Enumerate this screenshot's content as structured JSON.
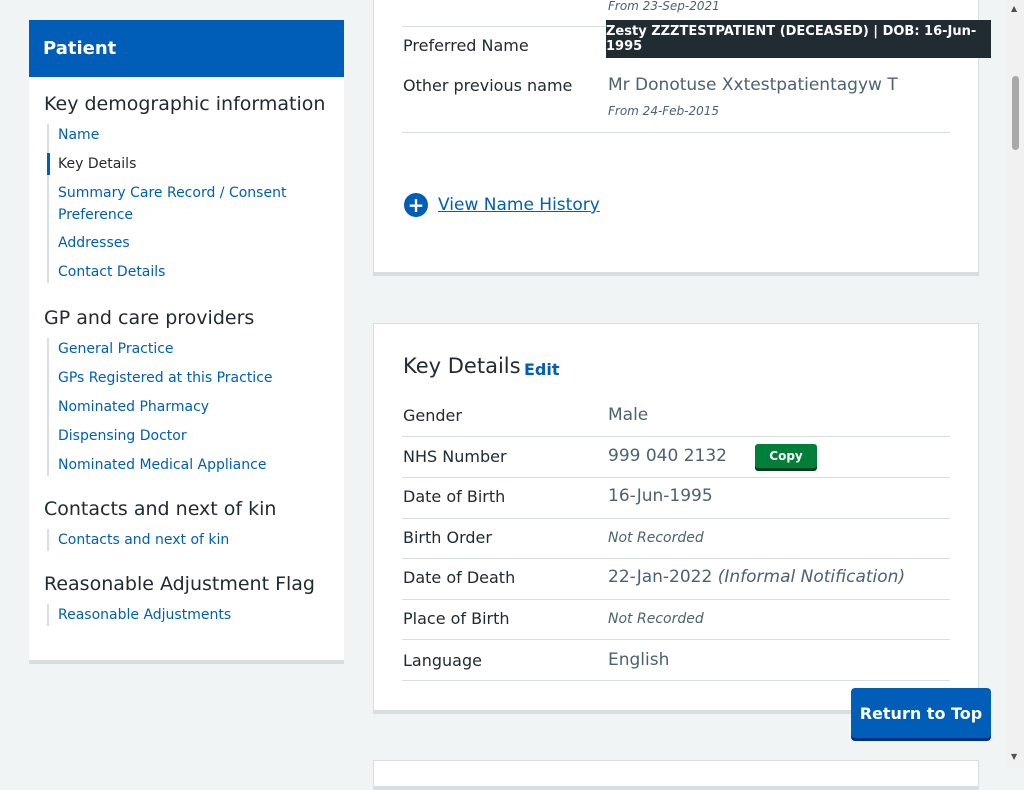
{
  "sidebar": {
    "title": "Patient",
    "sections": [
      {
        "title": "Key demographic information",
        "items": [
          "Name",
          "Key Details",
          "Summary Care Record / Consent",
          "Preference",
          "Addresses",
          "Contact Details"
        ]
      },
      {
        "title": "GP and care providers",
        "items": [
          "General Practice",
          "GPs Registered at this Practice",
          "Nominated Pharmacy",
          "Dispensing Doctor",
          "Nominated Medical Appliance"
        ]
      },
      {
        "title": "Contacts and next of kin",
        "items": [
          "Contacts and next of kin"
        ]
      },
      {
        "title": "Reasonable Adjustment Flag",
        "items": [
          "Reasonable Adjustments"
        ]
      }
    ]
  },
  "tooltip": {
    "text": "Zesty ZZZTESTPATIENT (DECEASED) | DOB: 16-Jun-1995"
  },
  "names_card": {
    "top_note": "From 23-Sep-2021",
    "preferred_name_label": "Preferred Name",
    "other_name_label": "Other previous name",
    "other_name_value": "Mr Donotuse Xxtestpatientagyw T",
    "other_name_note": "From 24-Feb-2015",
    "history_link": "View Name History"
  },
  "key_details": {
    "title": "Key Details",
    "edit": "Edit",
    "copy_label": "Copy",
    "rows": [
      {
        "label": "Gender",
        "value": "Male"
      },
      {
        "label": "NHS Number",
        "value": "999 040 2132"
      },
      {
        "label": "Date of Birth",
        "value": "16-Jun-1995"
      },
      {
        "label": "Birth Order",
        "value": "Not Recorded"
      },
      {
        "label": "Date of Death",
        "value": "22-Jan-2022",
        "extra": "(Informal Notification)"
      },
      {
        "label": "Place of Birth",
        "value": "Not Recorded"
      },
      {
        "label": "Language",
        "value": "English"
      }
    ]
  },
  "return_top": "Return to Top"
}
